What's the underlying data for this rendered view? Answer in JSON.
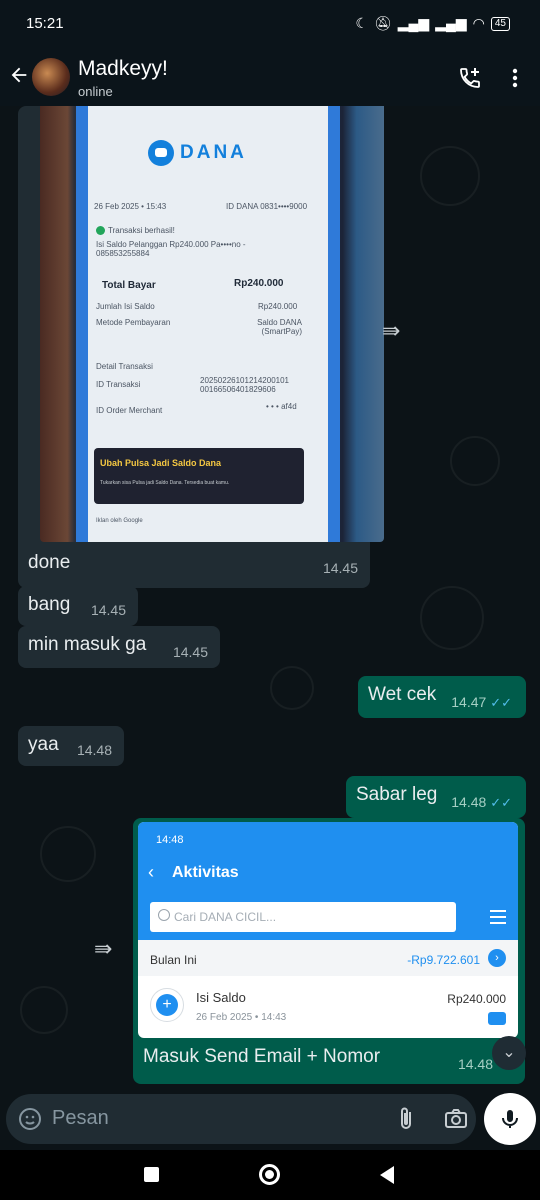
{
  "status_bar": {
    "time": "15:21",
    "battery": "45"
  },
  "header": {
    "contact_name": "Madkeyy!",
    "contact_status": "online",
    "icons": [
      "back-arrow-icon",
      "add-call-icon",
      "more-vert-icon"
    ]
  },
  "receipt_image": {
    "brand": "DANA",
    "date": "26 Feb 2025 • 15:43",
    "id_dana": "ID DANA 0831••••9000",
    "status": "Transaksi berhasil!",
    "description": "Isi Saldo Pelanggan Rp240.000 Pa••••no - 085853255884",
    "total_label": "Total Bayar",
    "total_value": "Rp240.000",
    "jumlah_label": "Jumlah Isi Saldo",
    "jumlah_value": "Rp240.000",
    "metode_label": "Metode Pembayaran",
    "metode_value": "Saldo DANA (SmartPay)",
    "detail_label": "Detail Transaksi",
    "id_transaksi_label": "ID Transaksi",
    "id_transaksi_value": "20250226101214200101 00166506401829606",
    "id_order_label": "ID Order Merchant",
    "id_order_value": "• • • af4d",
    "promo_title": "Ubah Pulsa Jadi Saldo Dana",
    "promo_sub": "Tukarkan sisa Pulsa jadi Saldo Dana. Tersedia buat kamu.",
    "footer": "Iklan oleh Google"
  },
  "messages": [
    {
      "dir": "in",
      "text": "done",
      "time": "14.45"
    },
    {
      "dir": "in",
      "text": "bang",
      "time": "14.45"
    },
    {
      "dir": "in",
      "text": "min masuk ga",
      "time": "14.45"
    },
    {
      "dir": "out",
      "text": "Wet cek",
      "time": "14.47"
    },
    {
      "dir": "in",
      "text": "yaa",
      "time": "14.48"
    },
    {
      "dir": "out",
      "text": "Sabar leg",
      "time": "14.48"
    },
    {
      "dir": "out",
      "text": "Masuk Send Email + Nomor",
      "time": "14.48"
    }
  ],
  "activity_image": {
    "time": "14:48",
    "title": "Aktivitas",
    "search_placeholder": "Cari DANA CICIL...",
    "section_label": "Bulan Ini",
    "section_total": "-Rp9.722.601",
    "row_title": "Isi Saldo",
    "row_date": "26 Feb 2025 • 14:43",
    "row_amount": "Rp240.000"
  },
  "composer": {
    "placeholder": "Pesan"
  },
  "colors": {
    "incoming": "#202c33",
    "outgoing": "#005c4b",
    "read_ticks": "#53bdeb",
    "dana_blue": "#1f8ff0"
  }
}
